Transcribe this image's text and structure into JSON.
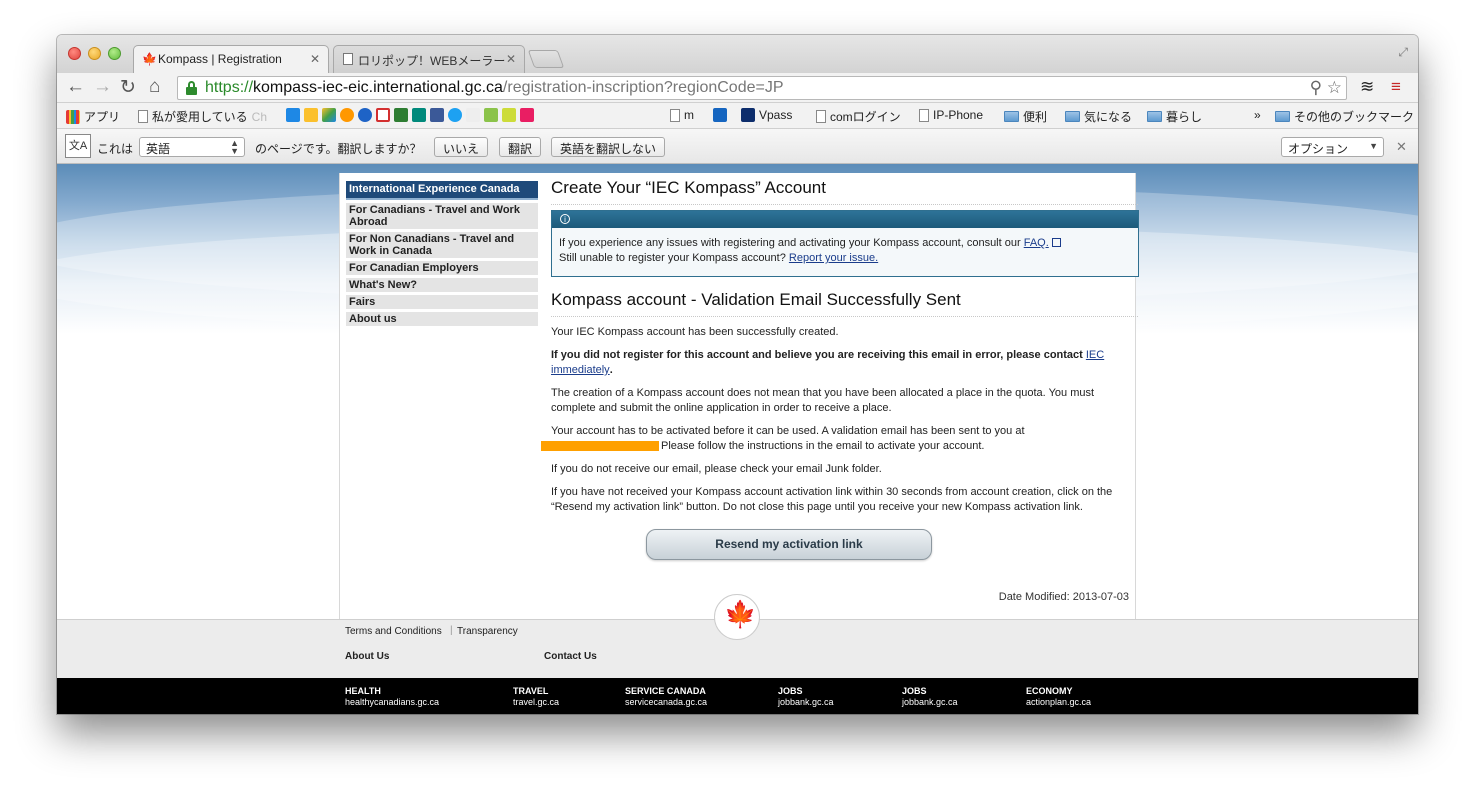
{
  "browser": {
    "tabs": [
      {
        "title": "Kompass | Registration",
        "active": true
      },
      {
        "title": "ロリポップ！WEBメーラー",
        "active": false
      }
    ],
    "url": {
      "scheme": "https://",
      "host": "kompass-iec-eic.international.gc.ca",
      "path": "/registration-inscription?regionCode=JP"
    }
  },
  "bookmarks": {
    "apps": "アプリ",
    "first": "私が愛用している",
    "first_fade": "Ch",
    "m": "m",
    "vpass": "Vpass",
    "com_login": "comログイン",
    "ip_phone": "IP-Phone",
    "benri": "便利",
    "kininaru": "気になる",
    "kurashi": "暮らし",
    "more": "»",
    "other": "その他のブックマーク"
  },
  "translate": {
    "prefix": "これは",
    "language": "英語",
    "question": "のページです。翻訳しますか？",
    "no": "いいえ",
    "translate": "翻訳",
    "never": "英語を翻訳しない",
    "options": "オプション"
  },
  "nav": {
    "heading": "International Experience Canada",
    "items": [
      "For Canadians - Travel and Work Abroad",
      "For Non Canadians - Travel and Work in Canada",
      "For Canadian Employers",
      "What's New?",
      "Fairs",
      "About us"
    ]
  },
  "main": {
    "title": "Create Your “IEC Kompass” Account",
    "info": {
      "line1_pre": "If you experience any issues with registering and activating your Kompass account, consult our ",
      "faq_link": "FAQ.",
      "line2_pre": "Still unable to register your Kompass account? ",
      "report_link": "Report your issue."
    },
    "subtitle": "Kompass account - Validation Email Successfully Sent",
    "p1": "Your IEC Kompass account has been successfully created.",
    "p2_pre": "If you did not register for this account and believe you are receiving this email in error, please contact ",
    "p2_link": "IEC immediately",
    "p2_post": ".",
    "p3": "The creation of a Kompass account does not mean that you have been allocated a place in the quota. You must complete and submit the online application in order to receive a place.",
    "p4_line1": "Your account has to be activated before it can be used. A validation email has been sent to you at",
    "p4_line2": "Please follow the instructions in the email to activate your account.",
    "p5": "If you do not receive our email, please check your email Junk folder.",
    "p6": "If you have not received your Kompass account activation link within 30 seconds from account creation, click on the “Resend my activation link” button. Do not close this page until you receive your new Kompass activation link.",
    "resend_button": "Resend my activation link",
    "date_modified": "Date Modified: 2013-07-03"
  },
  "footer": {
    "terms": "Terms and Conditions",
    "transparency": "Transparency",
    "about": "About Us",
    "contact": "Contact Us",
    "links": [
      {
        "title": "HEALTH",
        "url": "healthycanadians.gc.ca"
      },
      {
        "title": "TRAVEL",
        "url": "travel.gc.ca"
      },
      {
        "title": "SERVICE CANADA",
        "url": "servicecanada.gc.ca"
      },
      {
        "title": "JOBS",
        "url": "jobbank.gc.ca"
      },
      {
        "title": "JOBS",
        "url": "jobbank.gc.ca"
      },
      {
        "title": "ECONOMY",
        "url": "actionplan.gc.ca"
      }
    ]
  },
  "colors": {
    "nav_heading": "#1f4a7a",
    "info_bar": "#2e7398",
    "redaction": "#ffa000",
    "maple": "#d52b1e"
  }
}
